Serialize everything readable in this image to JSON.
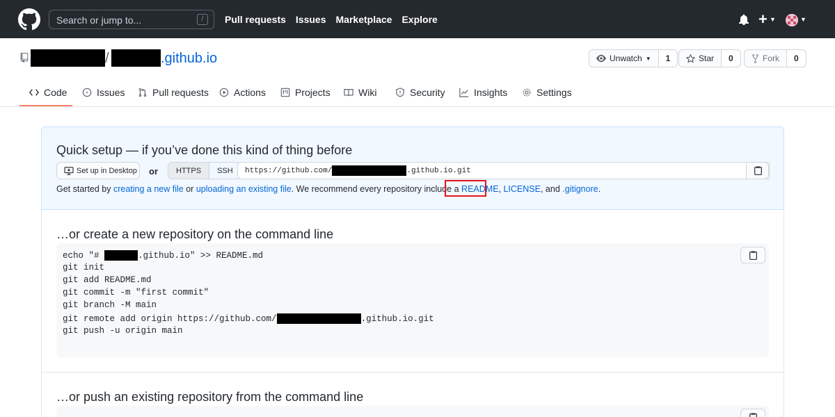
{
  "header": {
    "search_placeholder": "Search or jump to...",
    "search_shortcut": "/",
    "nav": [
      "Pull requests",
      "Issues",
      "Marketplace",
      "Explore"
    ],
    "plus_label": "+"
  },
  "repo": {
    "separator": "/",
    "name_suffix": ".github.io",
    "unwatch_label": "Unwatch",
    "unwatch_count": "1",
    "star_label": "Star",
    "star_count": "0",
    "fork_label": "Fork",
    "fork_count": "0"
  },
  "tabs": [
    "Code",
    "Issues",
    "Pull requests",
    "Actions",
    "Projects",
    "Wiki",
    "Security",
    "Insights",
    "Settings"
  ],
  "quick_setup": {
    "title": "Quick setup — if you’ve done this kind of thing before",
    "desktop_label": "Set up in Desktop",
    "or_label": "or",
    "https_label": "HTTPS",
    "ssh_label": "SSH",
    "url_prefix": "https://github.com/",
    "url_suffix": ".github.io.git",
    "gs_1": "Get started by ",
    "gs_link1": "creating a new file",
    "gs_2": " or ",
    "gs_link2": "uploading an existing file",
    "gs_3": ". We recommend every repository include a ",
    "gs_readme": "README",
    "gs_comma": ", ",
    "gs_license": "LICENSE",
    "gs_4": ", and ",
    "gs_gitignore": ".gitignore",
    "gs_5": "."
  },
  "new_repo": {
    "title": "…or create a new repository on the command line",
    "line1_a": "echo \"# ",
    "line1_b": ".github.io\" >> README.md",
    "line2": "git init",
    "line3": "git add README.md",
    "line4": "git commit -m \"first commit\"",
    "line5": "git branch -M main",
    "line6_a": "git remote add origin https://github.com/",
    "line6_b": ".github.io.git",
    "line7": "git push -u origin main"
  },
  "push_existing": {
    "title": "…or push an existing repository from the command line"
  }
}
